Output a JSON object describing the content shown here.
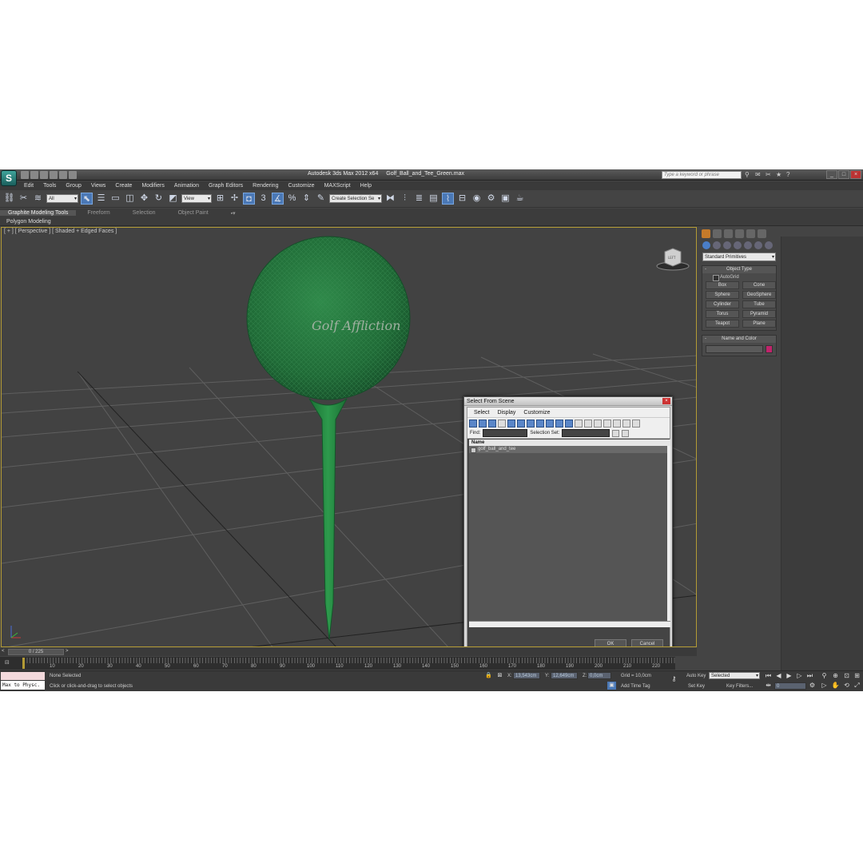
{
  "app": {
    "title": "Autodesk 3ds Max  2012 x64",
    "file": "Golf_Ball_and_Tee_Green.max",
    "search_placeholder": "Type a keyword or phrase"
  },
  "menu": [
    "Edit",
    "Tools",
    "Group",
    "Views",
    "Create",
    "Modifiers",
    "Animation",
    "Graph Editors",
    "Rendering",
    "Customize",
    "MAXScript",
    "Help"
  ],
  "toolbar": {
    "filter_value": "All",
    "refcoord_value": "View",
    "selection_set_value": "Create Selection Se"
  },
  "ribbon": {
    "tabs": [
      "Graphite Modeling Tools",
      "Freeform",
      "Selection",
      "Object Paint"
    ],
    "sub": "Polygon Modeling"
  },
  "viewport": {
    "label": "[ + ] [ Perspective ] [ Shaded + Edged Faces ]",
    "logo_text": "Golf Affliction",
    "cube_label": "LEFT"
  },
  "dialog": {
    "title": "Select From Scene",
    "menu": [
      "Select",
      "Display",
      "Customize"
    ],
    "find_label": "Find:",
    "selection_set_label": "Selection Set:",
    "column_name": "Name",
    "items": [
      "golf_ball_and_tee"
    ],
    "ok": "OK",
    "cancel": "Cancel"
  },
  "command_panel": {
    "dropdown": "Standard Primitives",
    "object_type_header": "Object Type",
    "autogrid": "AutoGrid",
    "buttons": [
      "Box",
      "Cone",
      "Sphere",
      "GeoSphere",
      "Cylinder",
      "Tube",
      "Torus",
      "Pyramid",
      "Teapot",
      "Plane"
    ],
    "name_color_header": "Name and Color",
    "swatch_color": "#c0246b"
  },
  "timeline": {
    "slider": "0 / 225",
    "ticks": [
      "10",
      "20",
      "30",
      "40",
      "50",
      "60",
      "70",
      "80",
      "90",
      "100",
      "110",
      "120",
      "130",
      "140",
      "150",
      "160",
      "170",
      "180",
      "190",
      "200",
      "210",
      "220"
    ]
  },
  "status": {
    "maxscript": "Max to Physc.",
    "selection": "None Selected",
    "prompt": "Click or click-and-drag to select objects",
    "x_label": "X:",
    "x_value": "13,543cm",
    "y_label": "Y:",
    "y_value": "12,649cm",
    "z_label": "Z:",
    "z_value": "0,0cm",
    "grid": "Grid = 10,0cm",
    "add_time_tag": "Add Time Tag",
    "auto_key": "Auto Key",
    "selected_dd": "Selected",
    "set_key": "Set Key",
    "key_filters": "Key Filters...",
    "frame": "0"
  }
}
